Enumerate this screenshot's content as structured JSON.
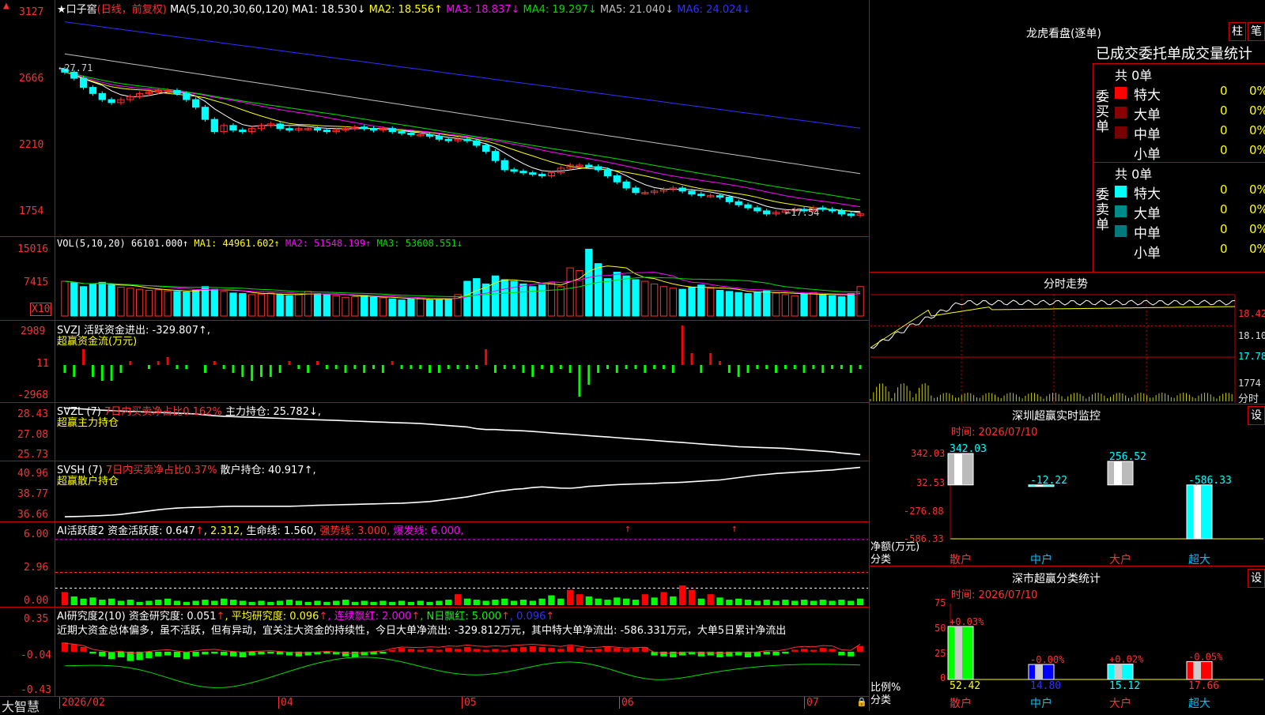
{
  "colors": {
    "up": "#ff3030",
    "down": "#00ffff",
    "grid": "#c00000",
    "ma1": "#ffffff",
    "ma2": "#ffff00",
    "ma3": "#ff00ff",
    "ma4": "#00dd00",
    "ma5": "#c0c0c0",
    "ma6": "#3030ff",
    "green": "#00ff00",
    "red": "#ff0000"
  },
  "main": {
    "legend": [
      {
        "text": "★口子窖",
        "color": "#ffffff"
      },
      {
        "text": "(日线，前复权)",
        "color": "#ff3030"
      },
      {
        "text": " MA(5,10,20,30,60,120) ",
        "color": "#ffffff"
      },
      {
        "text": "MA1: 18.530↓",
        "color": "#ffffff"
      },
      {
        "text": " MA2: 18.556↑",
        "color": "#ffff00"
      },
      {
        "text": " MA3: 18.837↓",
        "color": "#ff00ff"
      },
      {
        "text": " MA4: 19.297↓",
        "color": "#00dd00"
      },
      {
        "text": " MA5: 21.040↓",
        "color": "#c0c0c0"
      },
      {
        "text": " MA6: 24.024↓",
        "color": "#3030ff"
      }
    ],
    "yticks": [
      "3127",
      "2666",
      "2210",
      "1754"
    ],
    "high_label": "←27.71",
    "low_label": "←17.54"
  },
  "chart_data": [
    {
      "type": "candlestick",
      "name": "price",
      "ylim": [
        17.3,
        31.5
      ],
      "ma_names": [
        "MA1",
        "MA2",
        "MA3",
        "MA4",
        "MA5",
        "MA6"
      ],
      "ma_last": [
        18.53,
        18.556,
        18.837,
        19.297,
        21.04,
        24.024
      ],
      "close": [
        27.7,
        27.3,
        26.7,
        26.3,
        25.9,
        25.7,
        25.9,
        26.1,
        26.3,
        26.4,
        26.5,
        26.5,
        26.3,
        25.9,
        25.4,
        24.6,
        23.8,
        24.2,
        23.9,
        23.8,
        24.0,
        24.2,
        24.3,
        24.0,
        23.9,
        24.0,
        24.0,
        23.9,
        23.8,
        23.9,
        24.0,
        24.1,
        24.0,
        23.9,
        24.0,
        23.8,
        23.7,
        23.6,
        23.6,
        23.5,
        23.3,
        23.2,
        23.3,
        23.2,
        22.9,
        22.5,
        21.9,
        21.3,
        21.2,
        21.1,
        21.0,
        20.9,
        21.1,
        21.4,
        21.6,
        21.6,
        21.5,
        21.3,
        20.9,
        20.5,
        20.1,
        19.8,
        19.8,
        19.9,
        20.0,
        20.1,
        19.9,
        19.7,
        19.6,
        19.6,
        19.5,
        19.2,
        19.0,
        18.8,
        18.6,
        18.4,
        18.5,
        18.6,
        18.7,
        18.6,
        18.8,
        18.7,
        18.6,
        18.4,
        18.3,
        18.4
      ],
      "yticks": [
        31.27,
        26.66,
        22.1,
        17.54
      ]
    },
    {
      "type": "bar",
      "name": "VOL",
      "legend": "VOL(5,10,20) 66101.000↑",
      "ma": [
        "MA1: 44961.602↑",
        "MA2: 51548.199↑",
        "MA3: 53608.551↓"
      ],
      "yticks": [
        "15016",
        "7415"
      ],
      "unit": "X10",
      "values": [
        6.5,
        6.2,
        5.5,
        6.0,
        6.3,
        5.8,
        5.4,
        5.2,
        5.0,
        4.8,
        4.9,
        4.7,
        4.6,
        4.5,
        4.8,
        5.5,
        5.0,
        4.6,
        4.3,
        4.2,
        4.0,
        4.1,
        4.3,
        4.0,
        3.8,
        4.0,
        4.6,
        4.2,
        4.0,
        3.8,
        3.5,
        3.6,
        3.8,
        3.5,
        3.4,
        3.2,
        3.0,
        3.2,
        3.4,
        3.0,
        3.1,
        3.2,
        4.0,
        6.5,
        7.0,
        6.0,
        7.5,
        6.8,
        6.5,
        6.0,
        5.5,
        5.8,
        6.2,
        5.5,
        9.0,
        8.5,
        12.5,
        9.8,
        7.0,
        8.2,
        7.5,
        6.8,
        6.5,
        6.0,
        5.5,
        5.2,
        5.0,
        5.4,
        5.8,
        5.2,
        4.8,
        4.6,
        4.4,
        4.2,
        4.5,
        4.7,
        4.3,
        4.0,
        3.8,
        4.1,
        4.4,
        4.0,
        3.8,
        3.6,
        4.2,
        5.5
      ]
    },
    {
      "type": "bar",
      "name": "SVZJ",
      "label1": "SVZJ  活跃资金进出: -329.807↑,",
      "label2": "超赢资金流(万元)",
      "yticks": [
        "2989",
        "11",
        "-2968"
      ],
      "values": [
        -2,
        -3,
        4,
        -3,
        -4,
        -4,
        -2,
        1,
        0,
        -1,
        1,
        2,
        -1,
        -1,
        0,
        -2,
        1,
        -1,
        -2,
        -3,
        -4,
        -3,
        -3,
        -2,
        1,
        -1,
        -2,
        1,
        -1,
        -1,
        -2,
        -1,
        -2,
        -1,
        -2,
        1,
        -1,
        -1,
        -1,
        -2,
        -2,
        -1,
        -1,
        -1,
        -1,
        4,
        -2,
        -1,
        -1,
        -2,
        -3,
        -1,
        -2,
        -1,
        -2,
        -8,
        -5,
        -2,
        -1,
        -2,
        -1,
        -1,
        -2,
        -1,
        -1,
        -2,
        10,
        3,
        -2,
        3,
        1,
        -2,
        -3,
        -2,
        -1,
        -1,
        -2,
        -1,
        -1,
        -2,
        -1,
        -2,
        -1,
        -1,
        -2,
        -1
      ]
    },
    {
      "type": "line",
      "name": "SVZL",
      "legend": [
        {
          "text": "SVZL (7) ",
          "color": "#ffffff"
        },
        {
          "text": "7日内买卖净占比0.162%",
          "color": "#ff3030"
        },
        {
          "text": " 主力持仓: 25.782↓,",
          "color": "#ffffff"
        }
      ],
      "sublabel": "超赢主力持仓",
      "yticks": [
        "28.43",
        "27.08",
        "25.73"
      ],
      "ylim": [
        25.5,
        28.7
      ],
      "values": [
        28.5,
        28.47,
        28.44,
        28.4,
        28.37,
        28.35,
        28.32,
        28.3,
        28.28,
        28.26,
        28.24,
        28.22,
        28.2,
        28.18,
        28.15,
        28.1,
        28.05,
        28.02,
        28.0,
        27.98,
        27.96,
        27.94,
        27.92,
        27.9,
        27.88,
        27.86,
        27.84,
        27.82,
        27.8,
        27.78,
        27.76,
        27.74,
        27.72,
        27.7,
        27.68,
        27.66,
        27.64,
        27.62,
        27.6,
        27.56,
        27.52,
        27.48,
        27.44,
        27.4,
        27.3,
        27.25,
        27.25,
        27.22,
        27.2,
        27.18,
        27.14,
        27.1,
        27.06,
        27.02,
        26.98,
        26.94,
        26.9,
        26.86,
        26.82,
        26.78,
        26.74,
        26.7,
        26.66,
        26.62,
        26.58,
        26.54,
        26.5,
        26.46,
        26.42,
        26.38,
        26.34,
        26.3,
        26.26,
        26.24,
        26.22,
        26.2,
        26.18,
        26.16,
        26.12,
        26.08,
        26.04,
        26.0,
        25.96,
        25.9,
        25.85,
        25.8
      ]
    },
    {
      "type": "line",
      "name": "SVSH",
      "legend": [
        {
          "text": "SVSH (7) ",
          "color": "#ffffff"
        },
        {
          "text": "7日内买卖净占比0.37%",
          "color": "#ff3030"
        },
        {
          "text": " 散户持仓: 40.917↑,",
          "color": "#ffffff"
        }
      ],
      "sublabel": "超赢散户持仓",
      "yticks": [
        "40.96",
        "38.77",
        "36.66"
      ],
      "ylim": [
        36.3,
        41.3
      ],
      "values": [
        36.7,
        36.72,
        36.74,
        36.77,
        36.8,
        36.84,
        36.9,
        37.0,
        37.1,
        37.2,
        37.3,
        37.38,
        37.44,
        37.48,
        37.5,
        37.52,
        37.55,
        37.58,
        37.6,
        37.6,
        37.6,
        37.6,
        37.6,
        37.6,
        37.6,
        37.62,
        37.65,
        37.68,
        37.7,
        37.72,
        37.74,
        37.76,
        37.78,
        37.8,
        37.82,
        37.84,
        37.86,
        37.9,
        37.95,
        38.0,
        38.1,
        38.2,
        38.3,
        38.4,
        38.55,
        38.7,
        38.85,
        38.95,
        39.05,
        39.1,
        39.2,
        39.25,
        39.2,
        39.15,
        39.14,
        39.2,
        39.3,
        39.35,
        39.4,
        39.45,
        39.48,
        39.5,
        39.52,
        39.55,
        39.6,
        39.62,
        39.65,
        39.7,
        39.75,
        39.8,
        39.85,
        39.95,
        40.05,
        40.15,
        40.25,
        40.32,
        40.4,
        40.45,
        40.5,
        40.55,
        40.6,
        40.65,
        40.7,
        40.78,
        40.85,
        40.92
      ]
    },
    {
      "type": "bar",
      "name": "AI活跃度2",
      "legend": [
        {
          "text": "AI活跃度2 资金活跃度: 0.647",
          "color": "#ffffff"
        },
        {
          "text": "↑",
          "color": "#ff3030"
        },
        {
          "text": ", 2.312,",
          "color": "#ffff00"
        },
        {
          "text": " 生命线: 1.560,",
          "color": "#ffffff"
        },
        {
          "text": " 强势线: 3.000,",
          "color": "#ff3030"
        },
        {
          "text": " 爆发线: 6.000,",
          "color": "#ff00ff"
        }
      ],
      "yticks": [
        "6.00",
        "2.96",
        "0.00"
      ],
      "ylim": [
        0,
        6.5
      ],
      "lines": [
        6.0,
        3.0,
        1.56
      ],
      "values": [
        1.2,
        0.8,
        0.6,
        0.7,
        0.5,
        0.6,
        0.4,
        0.5,
        0.3,
        0.4,
        0.5,
        0.6,
        0.4,
        0.3,
        0.4,
        0.5,
        0.4,
        0.6,
        0.5,
        0.4,
        0.3,
        0.4,
        0.3,
        0.4,
        0.5,
        0.4,
        0.3,
        0.4,
        0.3,
        0.4,
        0.5,
        0.3,
        0.4,
        0.3,
        0.4,
        0.3,
        0.4,
        0.3,
        0.4,
        0.3,
        0.4,
        0.5,
        1.0,
        0.6,
        0.5,
        0.4,
        0.5,
        0.6,
        0.4,
        0.5,
        0.4,
        0.6,
        0.9,
        0.6,
        1.4,
        1.0,
        0.8,
        0.6,
        0.5,
        0.7,
        0.6,
        0.5,
        1.0,
        0.7,
        1.2,
        0.8,
        1.8,
        1.4,
        0.6,
        1.0,
        0.7,
        0.5,
        0.6,
        0.5,
        0.4,
        0.5,
        0.4,
        0.5,
        0.4,
        0.5,
        0.4,
        0.5,
        0.4,
        0.5,
        0.4,
        0.6
      ]
    },
    {
      "type": "bar",
      "name": "AI研究度2",
      "legend": [
        {
          "text": "AI研究度2(10) 资金研究度: 0.051",
          "color": "#ffffff"
        },
        {
          "text": "↑",
          "color": "#ff3030"
        },
        {
          "text": ", 平均研究度: 0.096",
          "color": "#ffff00"
        },
        {
          "text": "↑",
          "color": "#ff3030"
        },
        {
          "text": ", 连续飘红: 2.000",
          "color": "#ff00ff"
        },
        {
          "text": "↑",
          "color": "#ff3030"
        },
        {
          "text": ", N日飘红: 5.000",
          "color": "#00ff00"
        },
        {
          "text": "↑",
          "color": "#ff3030"
        },
        {
          "text": ", 0.096",
          "color": "#3030ff"
        },
        {
          "text": "↑",
          "color": "#ff3030"
        }
      ],
      "comment": "近期大资金总体偏多，虽不活跃，但有异动，宜关注大资金的持续性，今日大单净流出: -329.812万元，其中特大单净流出: -586.331万元，大单5日累计净流出",
      "yticks": [
        "0.35",
        "-0.04",
        "-0.43"
      ],
      "ylim": [
        -0.45,
        0.38
      ],
      "values": [
        0.1,
        0.08,
        0.05,
        -0.02,
        -0.05,
        -0.08,
        -0.06,
        -0.1,
        -0.09,
        -0.07,
        -0.05,
        -0.04,
        -0.06,
        -0.08,
        -0.05,
        -0.03,
        -0.02,
        -0.04,
        -0.05,
        -0.06,
        -0.04,
        -0.03,
        -0.02,
        -0.03,
        -0.04,
        -0.05,
        -0.04,
        -0.03,
        -0.02,
        -0.03,
        -0.05,
        -0.06,
        -0.04,
        -0.03,
        -0.02,
        0.02,
        0.04,
        0.03,
        0.02,
        0.03,
        0.02,
        0.04,
        0.03,
        0.05,
        0.03,
        0.02,
        0.03,
        0.02,
        0.04,
        0.05,
        0.06,
        0.05,
        0.04,
        0.03,
        0.06,
        0.04,
        0.02,
        0.03,
        0.05,
        0.04,
        0.03,
        0.04,
        0.05,
        -0.04,
        -0.05,
        -0.06,
        -0.04,
        -0.03,
        -0.05,
        -0.04,
        -0.06,
        -0.05,
        -0.04,
        -0.06,
        -0.05,
        -0.03,
        -0.04,
        -0.02,
        0.02,
        0.03,
        0.02,
        0.04,
        0.03,
        -0.04,
        -0.05,
        0.06
      ]
    },
    {
      "type": "line",
      "name": "分时走势",
      "yticks": [
        "18.42",
        "18.10",
        "17.78"
      ],
      "vol_tick": "1774",
      "vol_label": "分时"
    },
    {
      "type": "bar",
      "name": "深圳超赢实时监控",
      "date": "时间: 2026/07/10",
      "yticks": [
        "342.03",
        "32.53",
        "-276.88",
        "-586.33"
      ],
      "ylabel": "净额(万元)",
      "xlabel": "分类",
      "categories": [
        "散户",
        "中户",
        "大户",
        "超大"
      ],
      "values": [
        342.03,
        -12.22,
        256.52,
        -586.33
      ],
      "value_labels": [
        "342.03",
        "-12.22",
        "256.52",
        "-586.33"
      ],
      "ylim": [
        -586.33,
        342.03
      ]
    },
    {
      "type": "bar",
      "name": "深市超赢分类统计",
      "date": "时间: 2026/07/10",
      "yticks": [
        "75",
        "50",
        "25",
        "0"
      ],
      "ylabel": "比例%",
      "xlabel": "分类",
      "categories": [
        "散户",
        "中户",
        "大户",
        "超大"
      ],
      "values": [
        52.42,
        14.8,
        15.12,
        17.66
      ],
      "changes": [
        "+0.03%",
        "-0.00%",
        "+0.02%",
        "-0.05%"
      ],
      "ylim": [
        0,
        75
      ]
    }
  ],
  "xaxis": {
    "labels": [
      "2026/02",
      "04",
      "05",
      "06",
      "07"
    ],
    "app": "大智慧"
  },
  "right": {
    "title": "龙虎看盘(逐单)",
    "btn1": "柱",
    "btn2": "笔",
    "subtitle": "已成交委托单成交量统计",
    "buy": {
      "side": "委买单",
      "total": "共 0单",
      "rows": [
        {
          "label": "特大",
          "n": "0",
          "p": "0%",
          "color": "#ff0000"
        },
        {
          "label": "大单",
          "n": "0",
          "p": "0%",
          "color": "#8b0000"
        },
        {
          "label": "中单",
          "n": "0",
          "p": "0%",
          "color": "#7a0000"
        },
        {
          "label": "小单",
          "n": "0",
          "p": "0%",
          "color": ""
        }
      ]
    },
    "sell": {
      "side": "委卖单",
      "total": "共 0单",
      "rows": [
        {
          "label": "特大",
          "n": "0",
          "p": "0%",
          "color": "#00ffff"
        },
        {
          "label": "大单",
          "n": "0",
          "p": "0%",
          "color": "#008b8b"
        },
        {
          "label": "中单",
          "n": "0",
          "p": "0%",
          "color": "#007a7a"
        },
        {
          "label": "小单",
          "n": "0",
          "p": "0%",
          "color": ""
        }
      ]
    },
    "intraday_title": "分时走势",
    "set": "设"
  }
}
